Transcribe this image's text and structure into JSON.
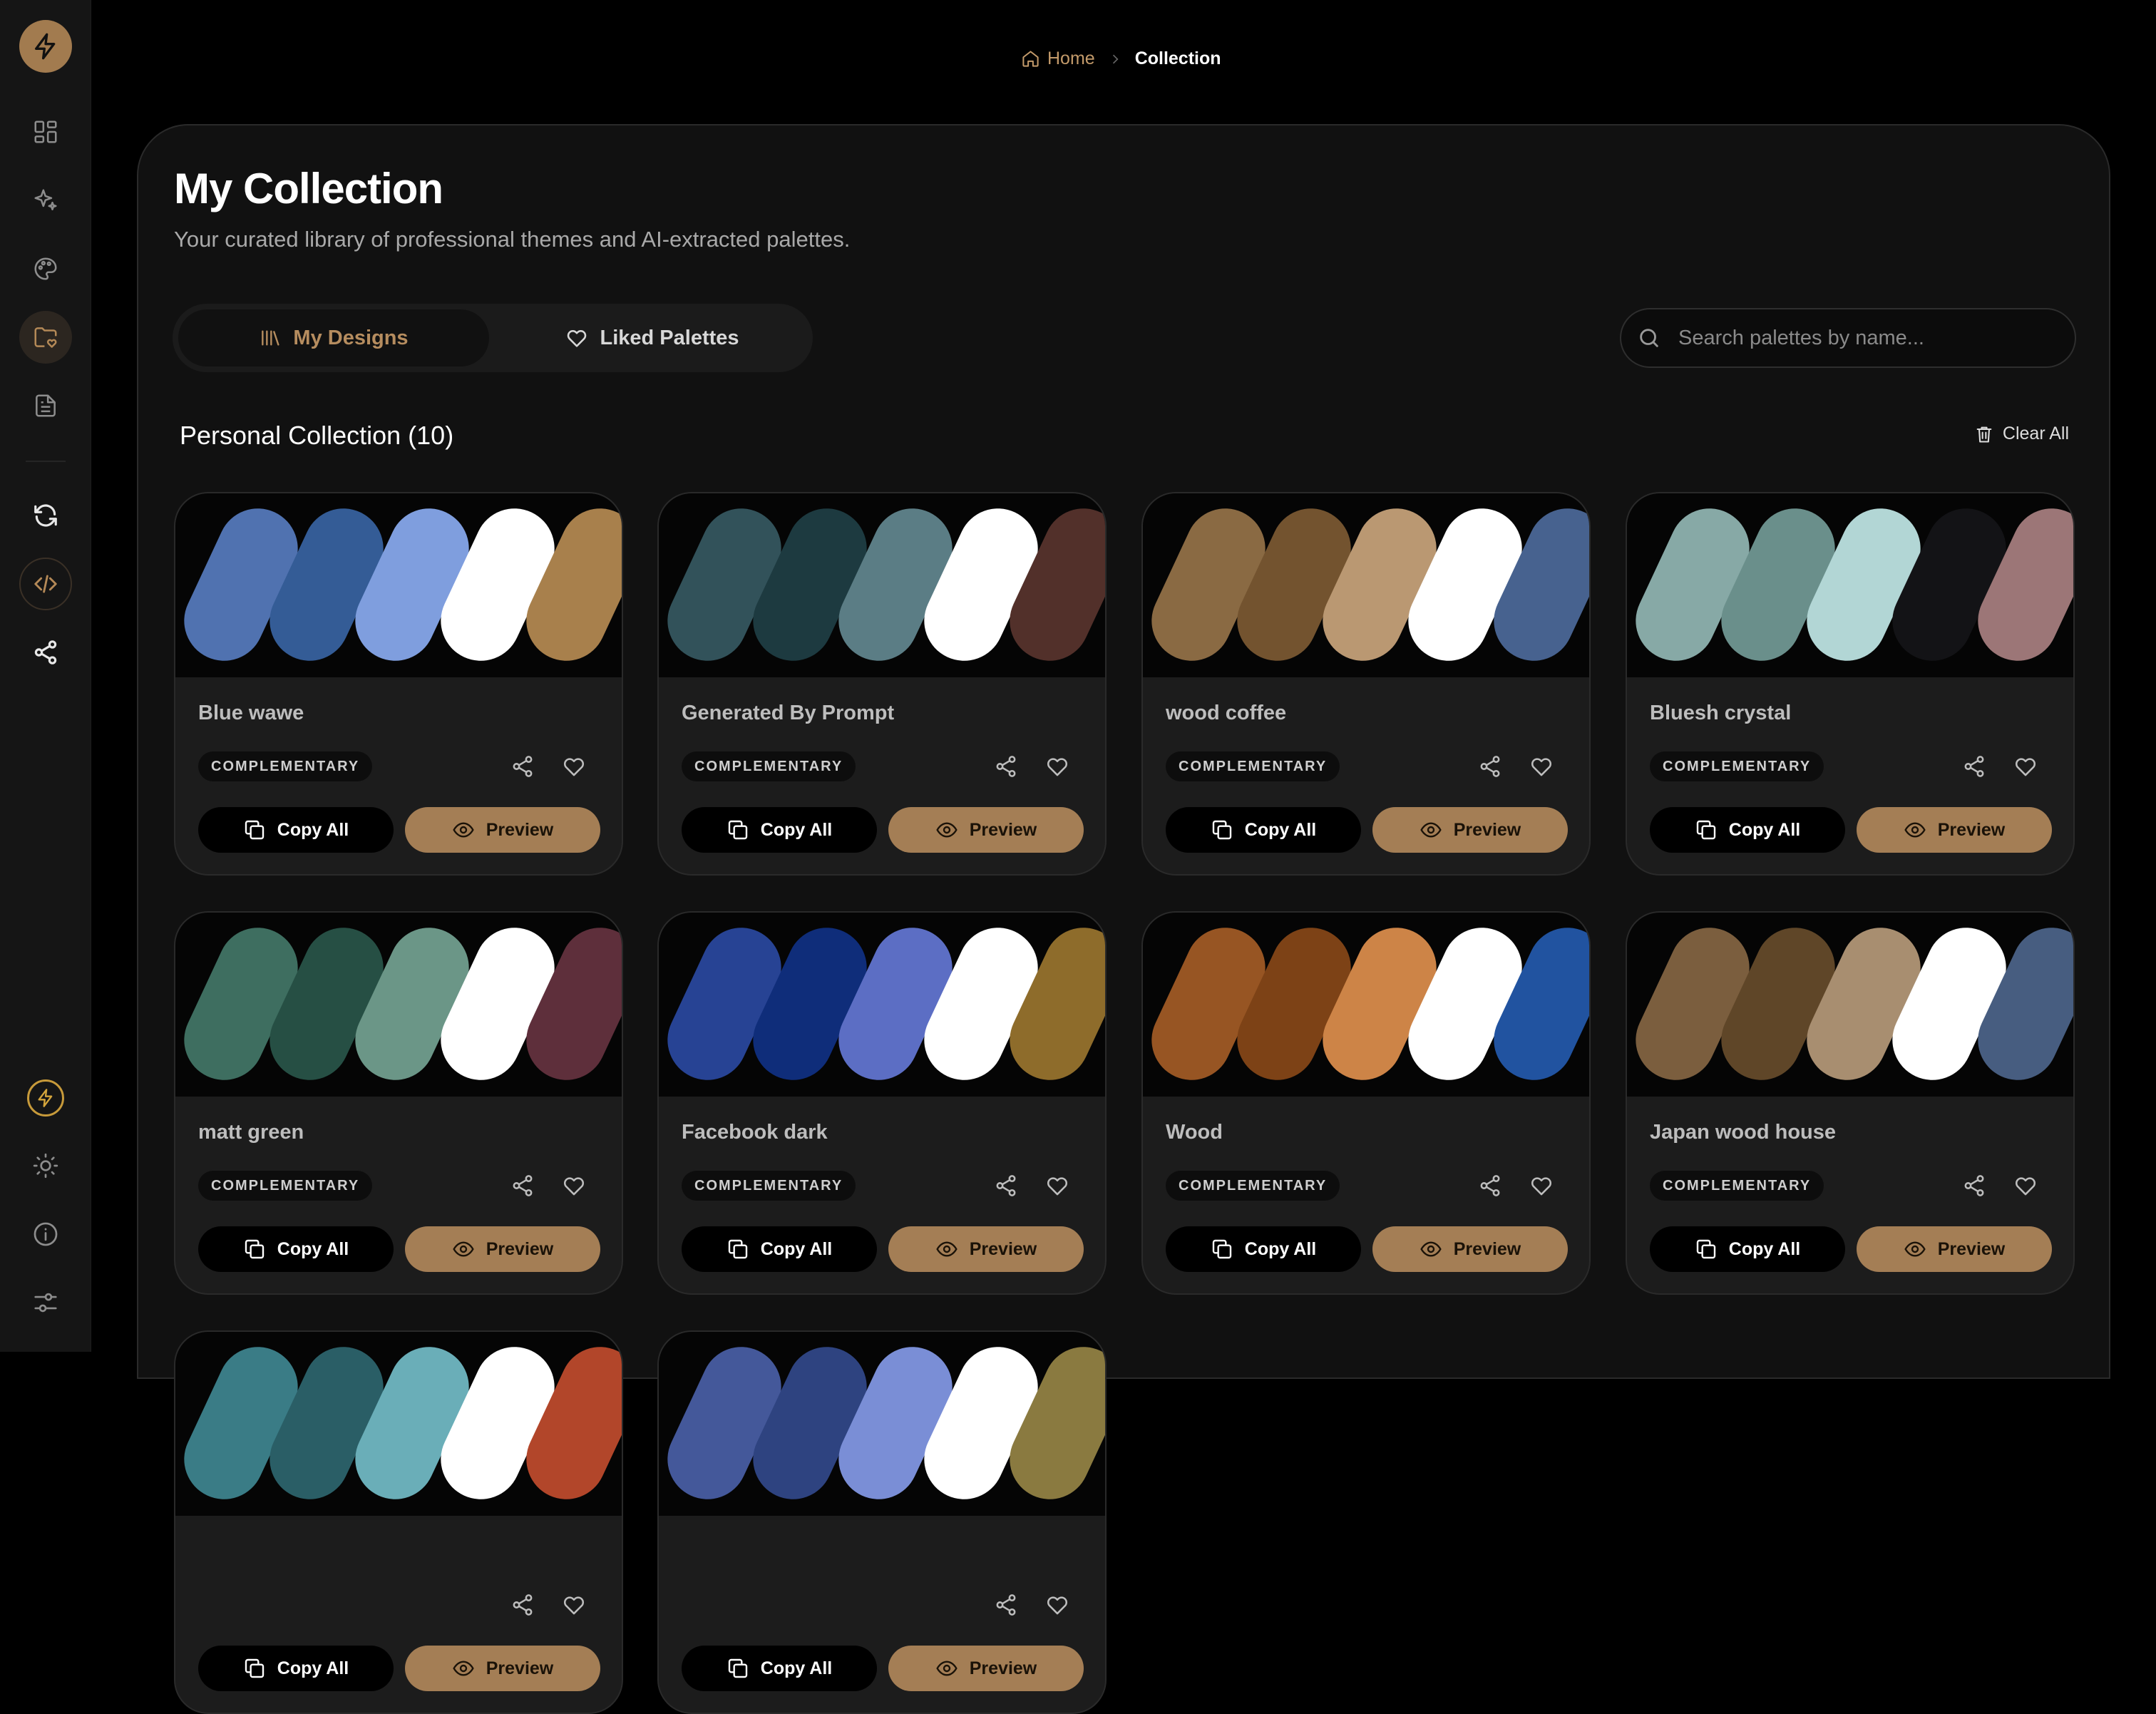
{
  "breadcrumb": {
    "home": "Home",
    "current": "Collection"
  },
  "page": {
    "title": "My Collection",
    "subtitle": "Your curated library of professional themes and AI-extracted palettes."
  },
  "tabs": {
    "designs": "My Designs",
    "liked": "Liked Palettes"
  },
  "search": {
    "placeholder": "Search palettes by name..."
  },
  "section": {
    "title": "Personal Collection (10)",
    "clear_all": "Clear All"
  },
  "labels": {
    "copy_all": "Copy All",
    "preview": "Preview"
  },
  "palettes": [
    {
      "name": "Blue wawe",
      "tag": "COMPLEMENTARY",
      "colors": [
        "#5072b0",
        "#345c96",
        "#7f9ede",
        "#ffffff",
        "#a8804c"
      ]
    },
    {
      "name": "Generated By Prompt",
      "tag": "COMPLEMENTARY",
      "colors": [
        "#32525a",
        "#1d3a40",
        "#5b7d85",
        "#ffffff",
        "#52302a"
      ]
    },
    {
      "name": "wood coffee",
      "tag": "COMPLEMENTARY",
      "colors": [
        "#8a6a43",
        "#73532f",
        "#ba9872",
        "#ffffff",
        "#47628f"
      ]
    },
    {
      "name": "Bluesh crystal",
      "tag": "COMPLEMENTARY",
      "colors": [
        "#87a9a6",
        "#6a8f8b",
        "#b2d6d5",
        "#131316",
        "#9c7677"
      ]
    },
    {
      "name": "matt green",
      "tag": "COMPLEMENTARY",
      "colors": [
        "#3e6e60",
        "#264f44",
        "#6b9687",
        "#ffffff",
        "#5e2f3b"
      ]
    },
    {
      "name": "Facebook dark",
      "tag": "COMPLEMENTARY",
      "colors": [
        "#274394",
        "#0f2d7a",
        "#5c6ec4",
        "#ffffff",
        "#8e6c2b"
      ]
    },
    {
      "name": "Wood",
      "tag": "COMPLEMENTARY",
      "colors": [
        "#975523",
        "#7d4216",
        "#cd8447",
        "#ffffff",
        "#2153a0"
      ]
    },
    {
      "name": "Japan wood house",
      "tag": "COMPLEMENTARY",
      "colors": [
        "#7b5e3e",
        "#5f4628",
        "#a88e70",
        "#ffffff",
        "#475d80"
      ]
    },
    {
      "name": "",
      "tag": "",
      "colors": [
        "#3a7c86",
        "#2a5e66",
        "#6aaeb8",
        "#ffffff",
        "#b2462a"
      ]
    },
    {
      "name": "",
      "tag": "",
      "colors": [
        "#44589a",
        "#2e4380",
        "#7a8ed6",
        "#ffffff",
        "#8a7a40"
      ]
    }
  ]
}
